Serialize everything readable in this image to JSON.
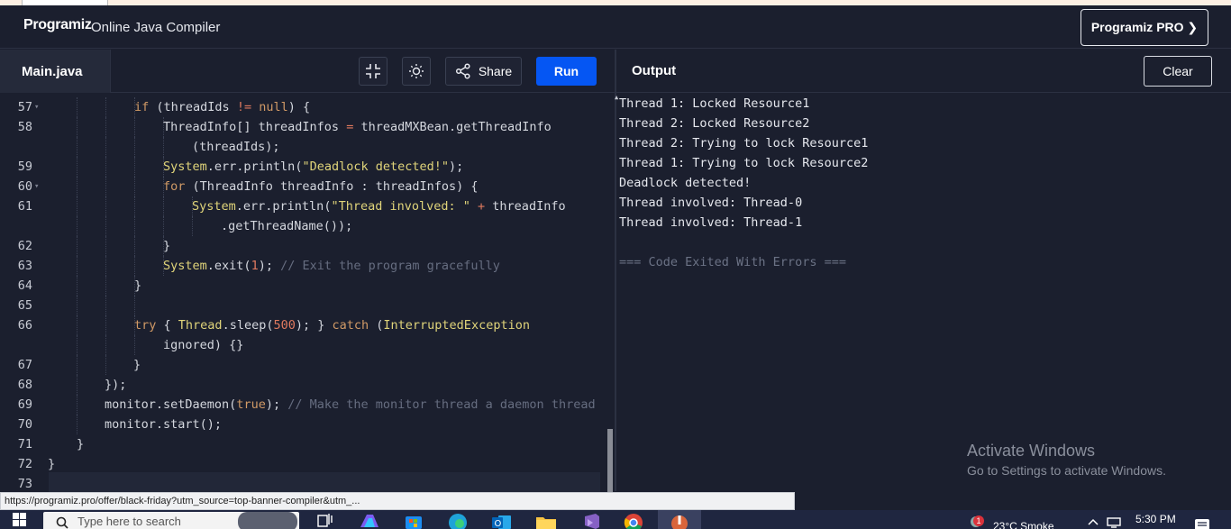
{
  "header": {
    "logo_text": "Programiz",
    "site_title": "Online Java Compiler",
    "pro_button": "Programiz PRO ❯"
  },
  "editor": {
    "file_tab": "Main.java",
    "share_label": "Share",
    "run_label": "Run",
    "lines": [
      {
        "n": "57",
        "fold": true
      },
      {
        "n": "58",
        "fold": false
      },
      {
        "n": "",
        "fold": false
      },
      {
        "n": "59",
        "fold": false
      },
      {
        "n": "60",
        "fold": true
      },
      {
        "n": "61",
        "fold": false
      },
      {
        "n": "",
        "fold": false
      },
      {
        "n": "62",
        "fold": false
      },
      {
        "n": "63",
        "fold": false
      },
      {
        "n": "64",
        "fold": false
      },
      {
        "n": "65",
        "fold": false
      },
      {
        "n": "66",
        "fold": false
      },
      {
        "n": "",
        "fold": false
      },
      {
        "n": "67",
        "fold": false
      },
      {
        "n": "68",
        "fold": false
      },
      {
        "n": "69",
        "fold": false
      },
      {
        "n": "70",
        "fold": false
      },
      {
        "n": "71",
        "fold": false
      },
      {
        "n": "72",
        "fold": false
      },
      {
        "n": "73",
        "fold": false
      }
    ]
  },
  "output": {
    "title": "Output",
    "clear_label": "Clear",
    "lines": [
      "Thread 1: Locked Resource1",
      "Thread 2: Locked Resource2",
      "Thread 2: Trying to lock Resource1",
      "Thread 1: Trying to lock Resource2",
      "Deadlock detected!",
      "Thread involved: Thread-0",
      "Thread involved: Thread-1",
      "",
      "=== Code Exited With Errors ==="
    ]
  },
  "watermark": {
    "line1": "Activate Windows",
    "line2": "Go to Settings to activate Windows."
  },
  "status_url": "https://programiz.pro/offer/black-friday?utm_source=top-banner-compiler&utm_...",
  "taskbar": {
    "search_placeholder": "Type here to search",
    "weather": "23°C  Smoke",
    "time": "5:30 PM",
    "notification_badge": "1"
  },
  "colors": {
    "background": "#1b1f2e",
    "run_button": "#0556f3",
    "keyword": "#d19a66",
    "string": "#e0d47a",
    "number": "#e07a5f",
    "comment": "#666d80"
  }
}
